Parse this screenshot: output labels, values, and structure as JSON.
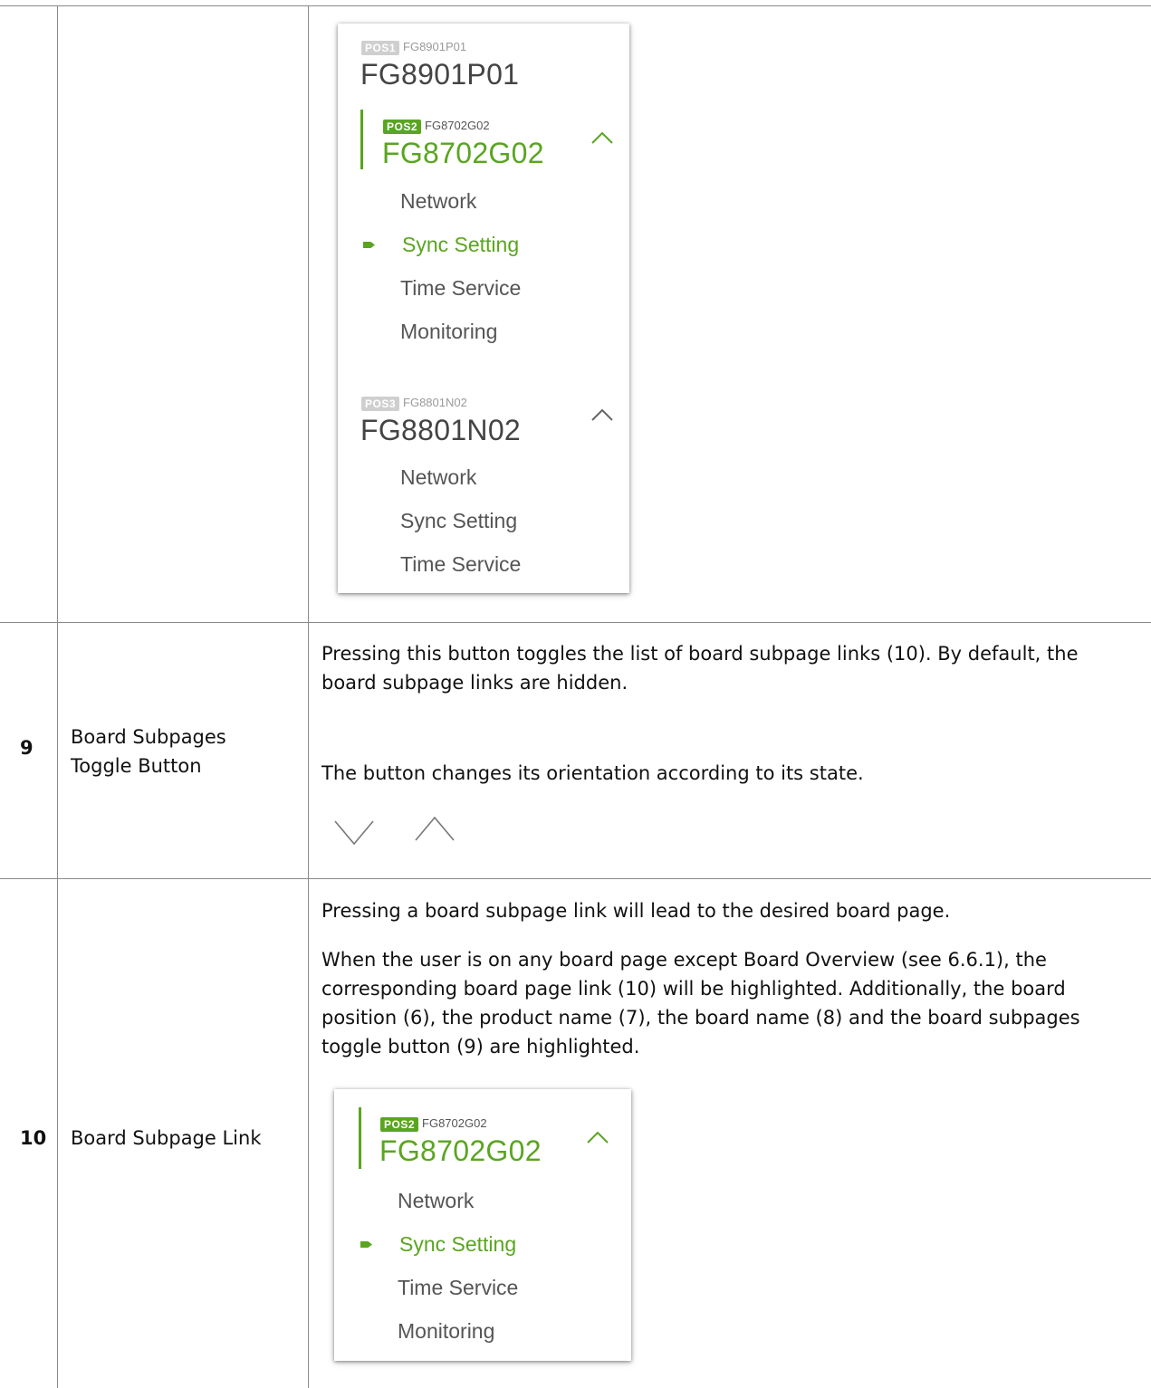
{
  "panel_top": {
    "boards": [
      {
        "pos": "POS1",
        "product": "FG8901P01",
        "name": "FG8901P01"
      },
      {
        "pos": "POS2",
        "product": "FG8702G02",
        "name": "FG8702G02",
        "links": [
          "Network",
          "Sync Setting",
          "Time Service",
          "Monitoring"
        ]
      },
      {
        "pos": "POS3",
        "product": "FG8801N02",
        "name": "FG8801N02",
        "links": [
          "Network",
          "Sync Setting",
          "Time Service"
        ]
      }
    ],
    "toggle_icon": "chevron-up-icon"
  },
  "row9": {
    "number": "9",
    "label": "Board Subpages Toggle Button",
    "desc1": "Pressing this button toggles the list of board subpage links (10). By default, the board subpage links are hidden.",
    "desc2": "The button changes its orientation according to its state.",
    "icons": [
      "chevron-down-icon",
      "chevron-up-icon"
    ]
  },
  "row10": {
    "number": "10",
    "label": "Board Subpage Link",
    "desc1": "Pressing a board subpage link will lead to the desired board page.",
    "desc2": "When the user is on any board page except Board Overview (see 6.6.1), the corresponding board page link (10) will be highlighted. Additionally, the board position (6), the product name (7), the board name (8) and the board subpages toggle button (9) are highlighted.",
    "board": {
      "pos": "POS2",
      "product": "FG8702G02",
      "name": "FG8702G02",
      "links": [
        "Network",
        "Sync Setting",
        "Time Service",
        "Monitoring"
      ]
    }
  },
  "colors": {
    "accent": "#5aa520",
    "border": "#8a8a8a",
    "muted": "#cfcfcf"
  }
}
